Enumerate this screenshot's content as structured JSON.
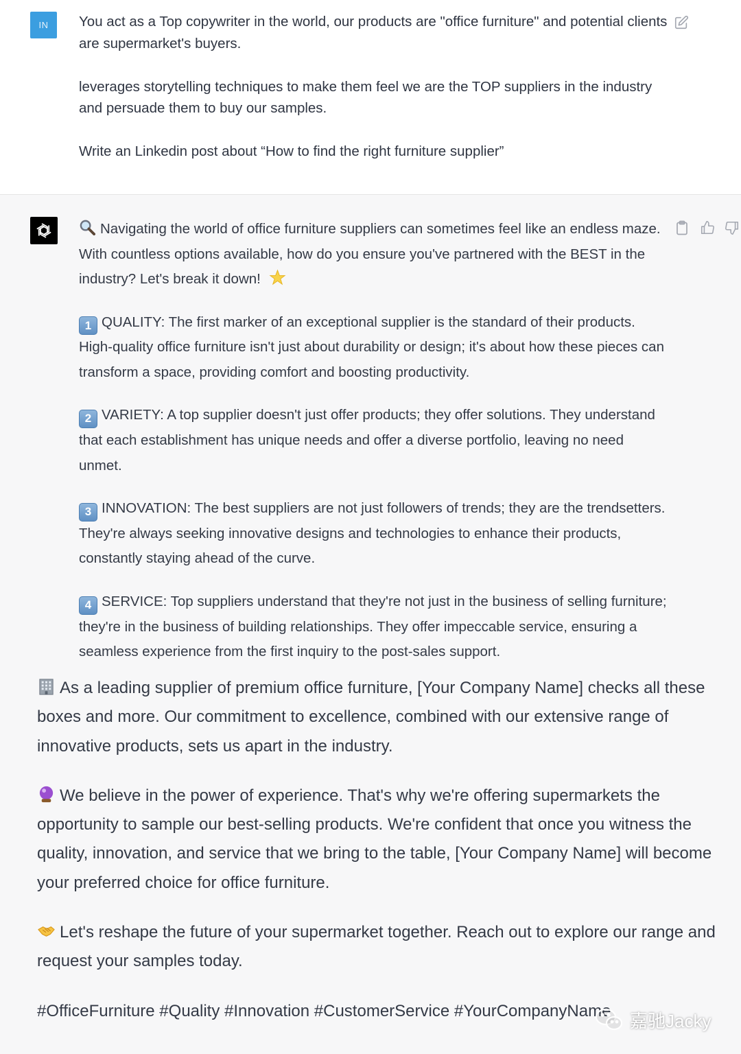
{
  "user_message": {
    "avatar_initials": "IN",
    "paragraphs": [
      "You act as a Top copywriter in the world, our products are \"office furniture\" and potential clients are supermarket's buyers.",
      "leverages storytelling techniques to make them feel we are the TOP suppliers in the industry and persuade them to buy our samples.",
      "Write an Linkedin post about “How to find the right furniture supplier”"
    ],
    "edit_icon": "edit-icon"
  },
  "assistant_message": {
    "avatar_icon": "openai-logo-icon",
    "actions": {
      "copy_icon": "clipboard-icon",
      "like_icon": "thumbs-up-icon",
      "dislike_icon": "thumbs-down-icon"
    },
    "intro": "Navigating the world of office furniture suppliers can sometimes feel like an endless maze. With countless options available, how do you ensure you've partnered with the BEST in the industry? Let's break it down!",
    "points": [
      {
        "key": "1",
        "text": "QUALITY: The first marker of an exceptional supplier is the standard of their products. High-quality office furniture isn't just about durability or design; it's about how these pieces can transform a space, providing comfort and boosting productivity."
      },
      {
        "key": "2",
        "text": "VARIETY: A top supplier doesn't just offer products; they offer solutions. They understand that each establishment has unique needs and offer a diverse portfolio, leaving no need unmet."
      },
      {
        "key": "3",
        "text": "INNOVATION: The best suppliers are not just followers of trends; they are the trendsetters. They're always seeking innovative designs and technologies to enhance their products, constantly staying ahead of the curve."
      },
      {
        "key": "4",
        "text": "SERVICE: Top suppliers understand that they're not just in the business of selling furniture; they're in the business of building relationships. They offer impeccable service, ensuring a seamless experience from the first inquiry to the post-sales support."
      }
    ],
    "company_paragraph": "As a leading supplier of premium office furniture, [Your Company Name] checks all these boxes and more. Our commitment to excellence, combined with our extensive range of innovative products, sets us apart in the industry.",
    "experience_paragraph": "We believe in the power of experience. That's why we're offering supermarkets the opportunity to sample our best-selling products. We're confident that once you witness the quality, innovation, and service that we bring to the table, [Your Company Name] will become your preferred choice for office furniture.",
    "cta_paragraph": "Let's reshape the future of your supermarket together. Reach out to explore our range and request your samples today.",
    "hashtags": "#OfficeFurniture #Quality #Innovation #CustomerService #YourCompanyName"
  },
  "watermark": {
    "text": "嘉驰Jacky",
    "icon": "wechat-icon"
  },
  "colors": {
    "user_bg": "#ffffff",
    "assistant_bg": "#f7f7f8",
    "user_avatar": "#3b9ee0",
    "text": "#343a46"
  }
}
